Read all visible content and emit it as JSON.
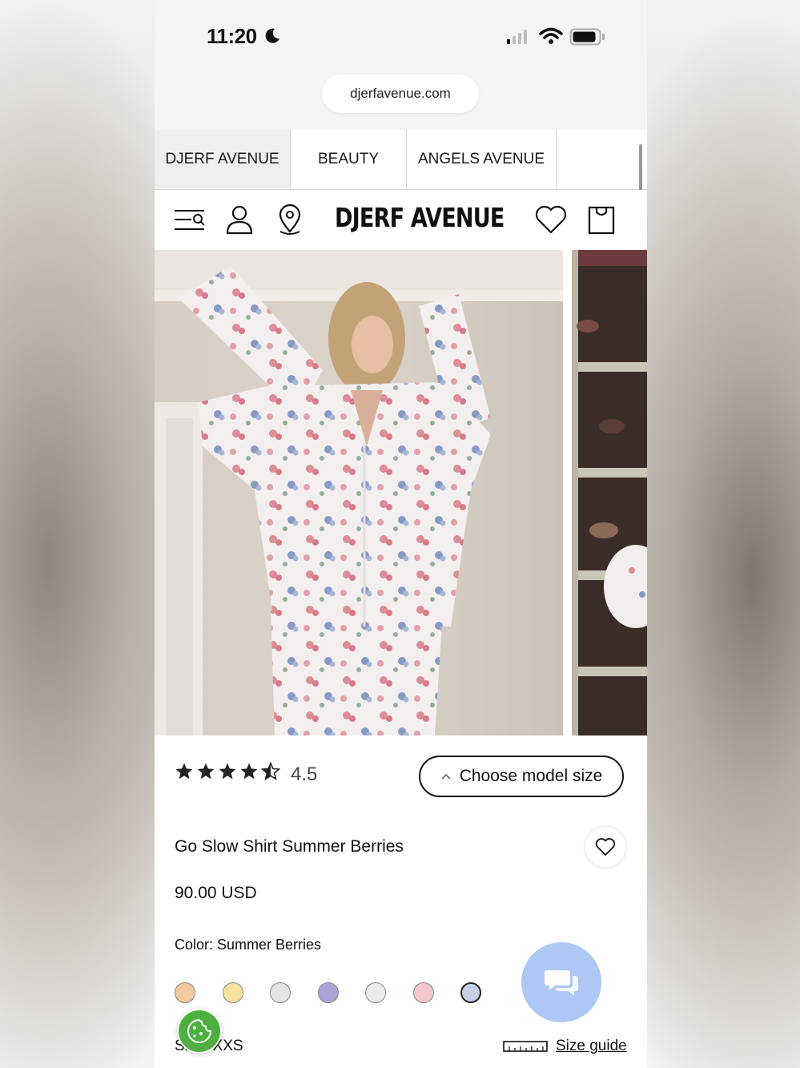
{
  "status_bar": {
    "time": "11:20"
  },
  "browser": {
    "url": "djerfavenue.com"
  },
  "brand_tabs": [
    {
      "label": "DJERF AVENUE",
      "active": true
    },
    {
      "label": "BEAUTY",
      "active": false
    },
    {
      "label": "ANGELS AVENUE",
      "active": false
    }
  ],
  "header": {
    "logo": "DJERF AVENUE"
  },
  "icons": {
    "menu": "menu-search-icon",
    "account": "user-icon",
    "location": "location-pin-icon",
    "wishlist": "heart-icon",
    "cart": "shopping-bag-icon",
    "chat": "chat-icon",
    "cookie": "cookie-icon",
    "ruler": "ruler-icon"
  },
  "product": {
    "rating": 4.5,
    "rating_label": "4.5",
    "model_size_button": "Choose model size",
    "title": "Go Slow Shirt Summer Berries",
    "price": "90.00 USD",
    "color_label": "Color: Summer Berries",
    "swatch_colors": [
      "#f3c9a2",
      "#f6e39d",
      "#e4e4e4",
      "#aaa3d3",
      "#ececec",
      "#f3c6cd",
      "#c5d1e2"
    ],
    "size_label": "Size: XXS",
    "size_guide": "Size guide"
  }
}
